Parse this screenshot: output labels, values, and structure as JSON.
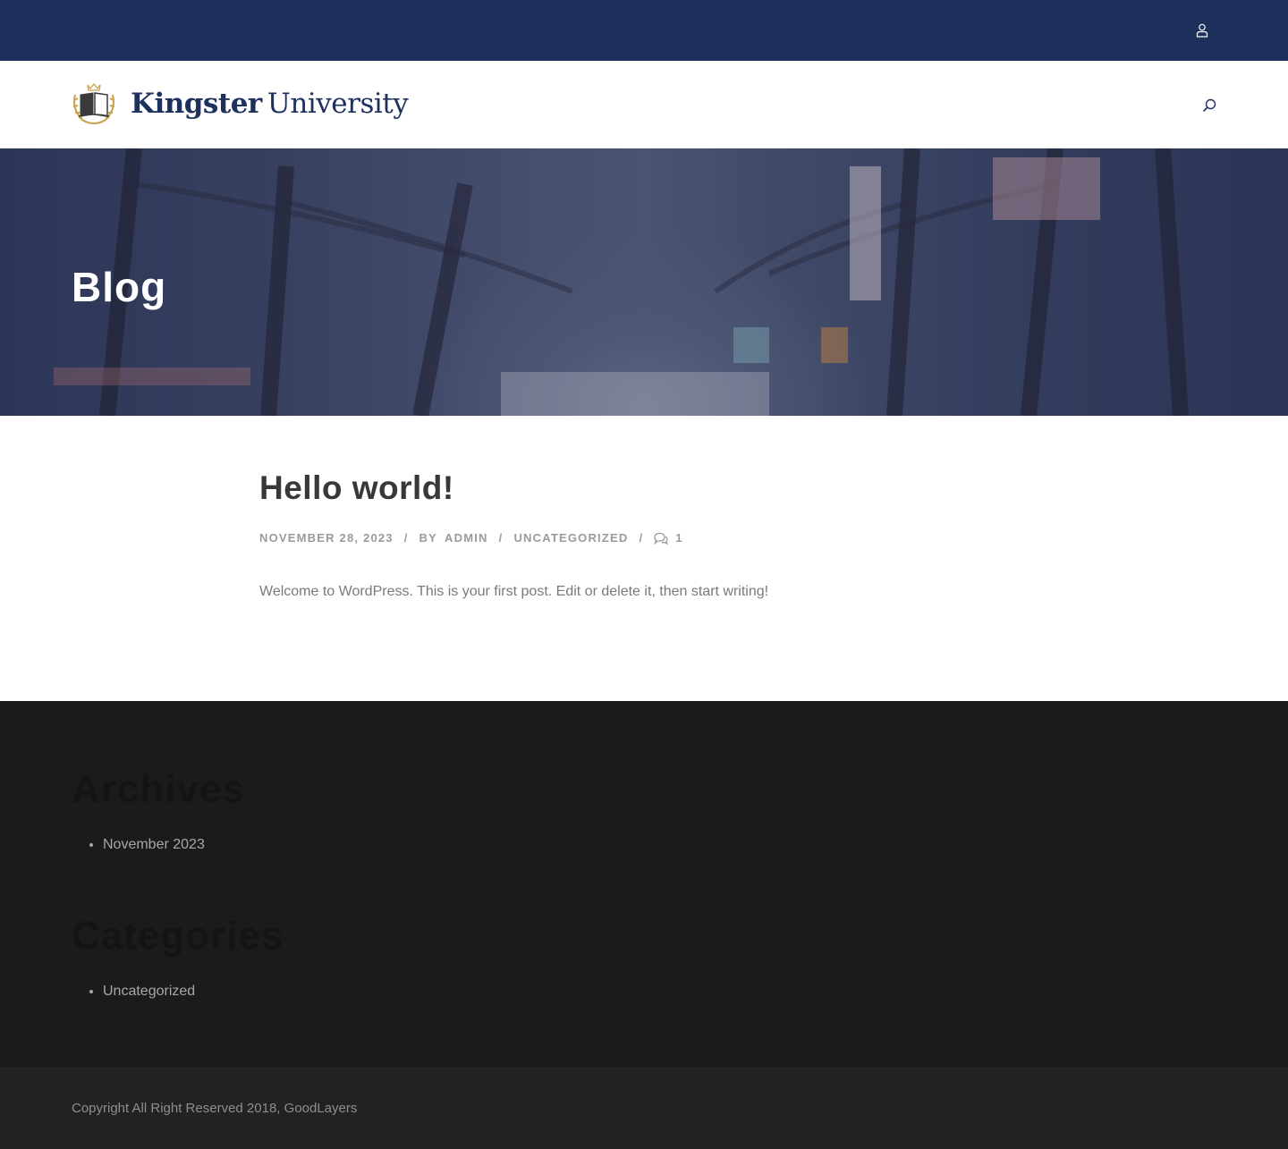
{
  "site": {
    "brand_strong": "Kingster",
    "brand_light": "University"
  },
  "topbar": {
    "background": "#1e315d",
    "user_icon": "user-icon"
  },
  "header": {
    "search_icon": "search-icon"
  },
  "hero": {
    "title": "Blog"
  },
  "post": {
    "title": "Hello world!",
    "meta": {
      "date": "November 28, 2023",
      "by_label": "By",
      "author": "Admin",
      "category": "Uncategorized",
      "comment_count": "1",
      "comment_icon": "comments-icon"
    },
    "excerpt": "Welcome to WordPress. This is your first post. Edit or delete it, then start writing!"
  },
  "footer": {
    "background": "#1b1b1b",
    "widgets": [
      {
        "title": "Archives",
        "items": [
          "November 2023"
        ]
      },
      {
        "title": "Categories",
        "items": [
          "Uncategorized"
        ]
      }
    ]
  },
  "copyright": {
    "text": "Copyright All Right Reserved 2018, GoodLayers"
  },
  "colors": {
    "brand_navy": "#1e315d",
    "logo_gold": "#c9a24a"
  }
}
